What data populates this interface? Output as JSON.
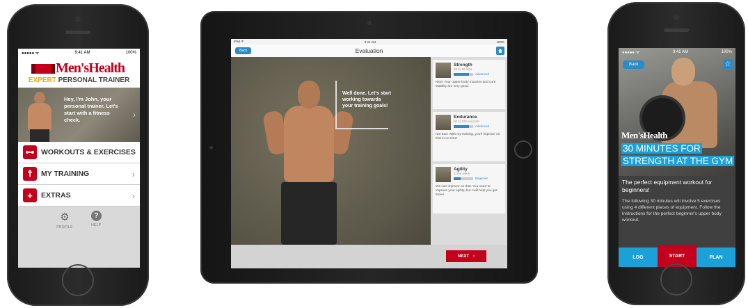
{
  "left_phone": {
    "status": {
      "carrier": "●●●●● ᯤ",
      "time": "9:41 AM",
      "battery": "100%"
    },
    "logo": {
      "brand": "Men'sHealth",
      "expert": "EXPERT",
      "trainer": "PERSONAL TRAINER"
    },
    "hero_text": "Hey, I'm John, your personal trainer. Let's start with a fitness check.",
    "menu": [
      {
        "label": "WORKOUTS & EXERCISES",
        "icon": "dumbbell-icon"
      },
      {
        "label": "MY TRAINING",
        "icon": "figure-icon"
      },
      {
        "label": "EXTRAS",
        "icon": "plus-icon"
      }
    ],
    "bottom": {
      "profile_label": "PROFILE",
      "help_label": "HELP"
    }
  },
  "tablet": {
    "status": {
      "carrier": "iPad ᯤ",
      "time": "9:41 AM",
      "battery": "100%"
    },
    "nav": {
      "back_label": "Back",
      "title": "Evaluation"
    },
    "speech": "Well done. Let's start working towards your training goals!",
    "cards": [
      {
        "title": "Strength",
        "subtitle": "20 to 40 reps",
        "level": "Advanced",
        "progress": 0.8,
        "text": "Nice! Your upper-body muscles and core stability are very good."
      },
      {
        "title": "Endurance",
        "subtitle": "60 to 120 seconds",
        "level": "Advanced",
        "progress": 0.8,
        "text": "Not bad. With my training, you'll improve on that in no time!"
      },
      {
        "title": "Agility",
        "subtitle": "to the ankle",
        "level": "Beginner",
        "progress": 0.35,
        "text": "We can improve on that. You need to improve your agility, but I will help you get there!"
      }
    ],
    "next_label": "NEXT"
  },
  "right_phone": {
    "status": {
      "carrier": "●●●●● ᯤ",
      "time": "9:41 AM",
      "battery": "100%"
    },
    "back_label": "Back",
    "brand": "Men'sHealth",
    "headline_1": "30 MINUTES FOR",
    "headline_2": "STRENGTH AT THE GYM",
    "subtitle": "The perfect equipment workout for beginners!",
    "description": "The following 30 minutes will involve 5 exercises using 4 different pieces of equipment. Follow the instructions for the perfect beginner's upper body workout.",
    "tabs": {
      "log": "LOG",
      "start": "START",
      "plan": "PLAN"
    }
  }
}
